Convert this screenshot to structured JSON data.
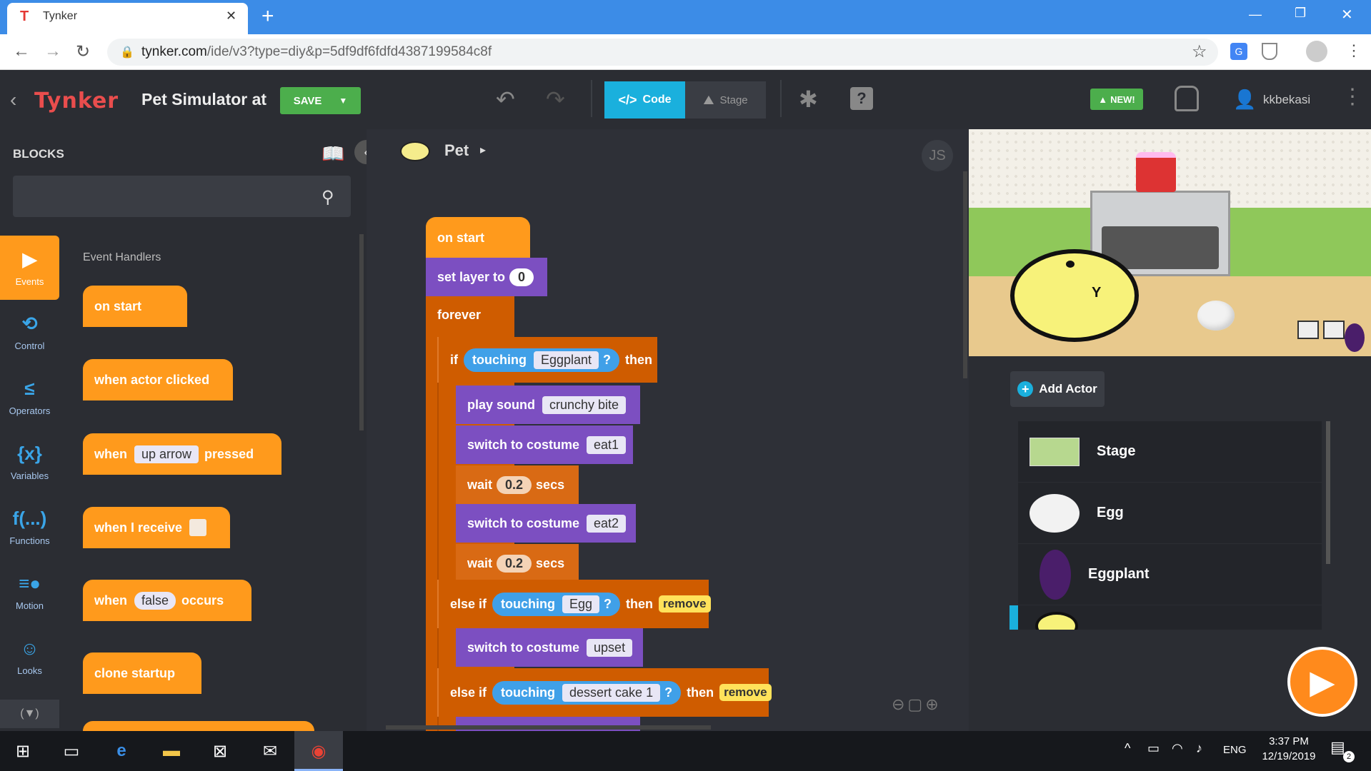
{
  "browser": {
    "tab_title": "Tynker",
    "url_host": "tynker.com",
    "url_path": "/ide/v3?type=diy&p=5df9df6fdfd4387199584c8f",
    "new_tab": "+",
    "close_tab": "✕"
  },
  "app": {
    "logo": "Tynker",
    "project_title": "Pet Simulator at",
    "save_label": "SAVE",
    "code_tab": "Code",
    "stage_tab": "Stage",
    "new_badge": "NEW!",
    "username": "kkbekasi",
    "js_label": "JS"
  },
  "blocks_panel": {
    "title": "BLOCKS",
    "search_placeholder": "",
    "section_title": "Event Handlers",
    "palette": [
      {
        "label": "on start"
      },
      {
        "label": "when actor clicked"
      },
      {
        "pre": "when",
        "field": "up arrow",
        "post": "pressed"
      },
      {
        "pre": "when I receive"
      },
      {
        "pre": "when",
        "field": "false",
        "post": "occurs"
      },
      {
        "label": "clone startup"
      }
    ]
  },
  "categories": [
    {
      "name": "Events",
      "icon": "play-icon"
    },
    {
      "name": "Control",
      "icon": "loop-icon"
    },
    {
      "name": "Operators",
      "icon": "less-equal-icon"
    },
    {
      "name": "Variables",
      "icon": "braces-icon"
    },
    {
      "name": "Functions",
      "icon": "function-icon"
    },
    {
      "name": "Motion",
      "icon": "motion-icon"
    },
    {
      "name": "Looks",
      "icon": "mask-icon"
    }
  ],
  "script": {
    "actor_name": "Pet",
    "on_start": "on start",
    "set_layer": "set layer to",
    "layer_value": "0",
    "forever": "forever",
    "if": "if",
    "touching": "touching",
    "then": "then",
    "touch1": "Eggplant",
    "play_sound": "play sound",
    "sound_name": "crunchy bite",
    "switch_costume": "switch to costume",
    "costume1": "eat1",
    "wait": "wait",
    "wait1": "0.2",
    "secs": "secs",
    "costume2": "eat2",
    "wait2": "0.2",
    "else_if": "else if",
    "touch2": "Egg",
    "remove": "remove",
    "costume3": "upset",
    "touch3": "dessert cake 1",
    "q": "?"
  },
  "stage": {
    "add_actor": "Add Actor",
    "actors": [
      {
        "name": "Stage"
      },
      {
        "name": "Egg"
      },
      {
        "name": "Eggplant"
      }
    ]
  },
  "taskbar": {
    "lang": "ENG",
    "time": "3:37 PM",
    "date": "12/19/2019",
    "notif_count": "2"
  },
  "colors": {
    "event_orange": "#ff9a1c",
    "control_orange": "#cf5c00",
    "looks_purple": "#7c4fc1",
    "sensing_blue": "#40a0e8",
    "save_green": "#4cae4c",
    "code_tab_blue": "#1ab0dd"
  }
}
